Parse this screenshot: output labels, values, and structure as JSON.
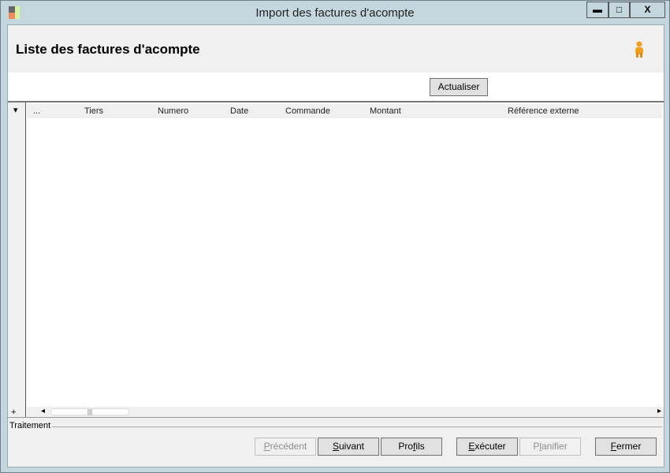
{
  "window": {
    "title": "Import des factures d'acompte",
    "minimize": "▬",
    "maximize": "□",
    "close": "X"
  },
  "header": {
    "title": "Liste des factures d'acompte",
    "user_icon": "user-icon"
  },
  "toolbar": {
    "refresh": "Actualiser"
  },
  "grid": {
    "row_header_menu": "▾",
    "columns": [
      "...",
      "Tiers",
      "Numero",
      "Date",
      "Commande",
      "Montant",
      "Référence externe"
    ],
    "rows": [],
    "add_row": "+",
    "scroll_left": "◂",
    "scroll_right": "▸",
    "thumb_grip": "|||"
  },
  "footer": {
    "section_label": "Traitement",
    "buttons": [
      {
        "pre": "",
        "key": "P",
        "post": "récédent",
        "enabled": false
      },
      {
        "pre": "",
        "key": "S",
        "post": "uivant",
        "enabled": true
      },
      {
        "pre": "Pro",
        "key": "f",
        "post": "ils",
        "enabled": true
      },
      {
        "pre": "",
        "key": "E",
        "post": "xécuter",
        "enabled": true
      },
      {
        "pre": "P",
        "key": "l",
        "post": "anifier",
        "enabled": false
      },
      {
        "pre": "",
        "key": "F",
        "post": "ermer",
        "enabled": true
      }
    ]
  }
}
